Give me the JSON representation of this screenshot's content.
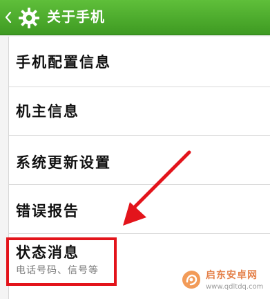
{
  "header": {
    "title": "关于手机"
  },
  "settings": {
    "items": [
      {
        "label": "手机配置信息"
      },
      {
        "label": "机主信息"
      },
      {
        "label": "系统更新设置"
      },
      {
        "label": "错误报告"
      },
      {
        "label": "状态消息",
        "subtitle": "电话号码、信号等"
      }
    ]
  },
  "annotation": {
    "color": "#e3141b",
    "highlighted_item": "状态消息"
  },
  "watermark": {
    "name": "启东安卓网",
    "url": "www.qdltdq.com"
  },
  "colors": {
    "header_top": "#5fbf3a",
    "header_bottom": "#3e9a22"
  }
}
